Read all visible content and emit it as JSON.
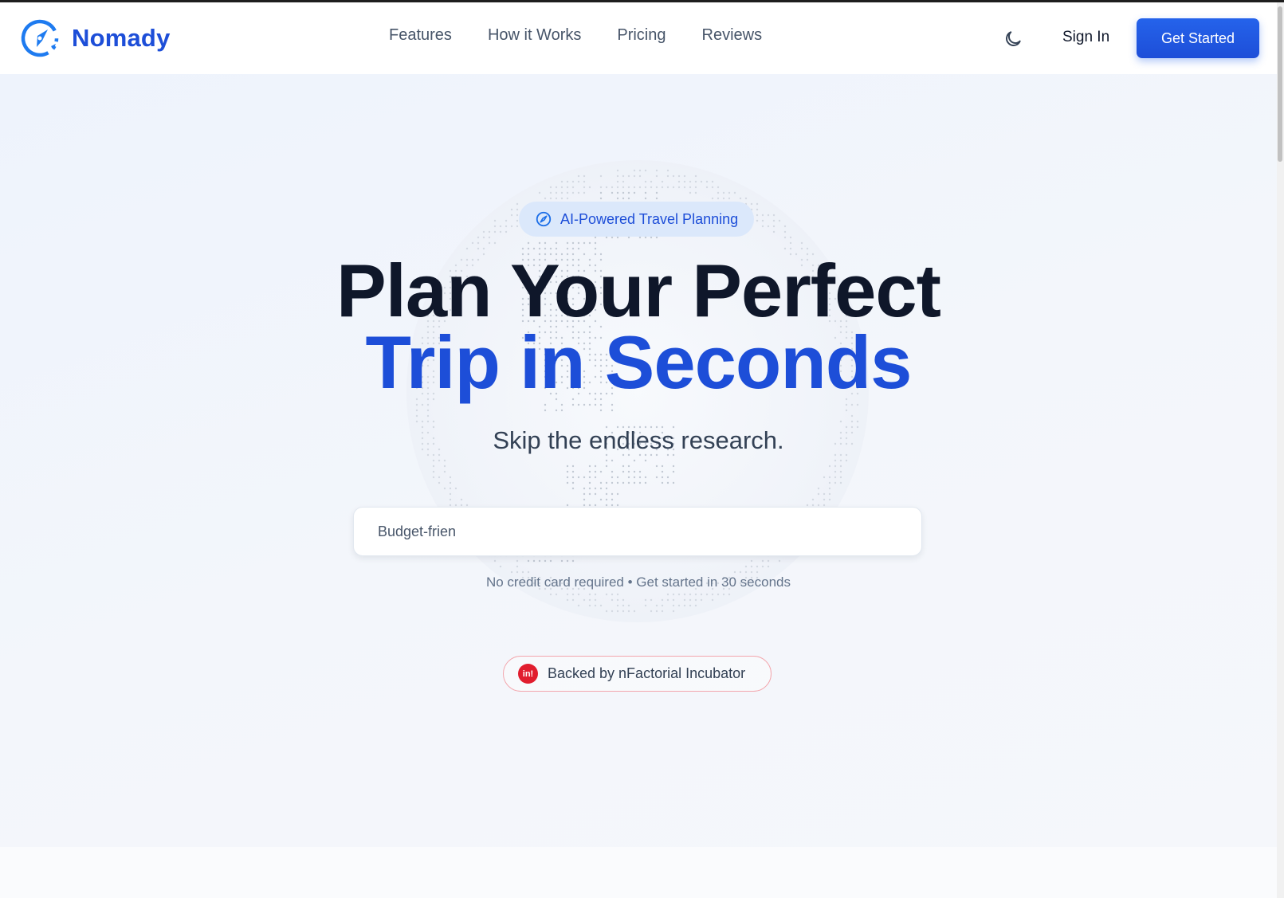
{
  "header": {
    "brand_name": "Nomady",
    "nav": [
      "Features",
      "How it Works",
      "Pricing",
      "Reviews"
    ],
    "theme_toggle_icon": "moon-icon",
    "sign_in_label": "Sign In",
    "get_started_label": "Get Started"
  },
  "hero": {
    "badge_label": "AI-Powered Travel Planning",
    "badge_icon": "compass-icon",
    "headline_line1": "Plan Your Perfect",
    "headline_line2": "Trip in Seconds",
    "subheadline": "Skip the endless research.",
    "search_value": "Budget-frien",
    "fineprint": "No credit card required • Get started in 30 seconds",
    "backed_logo_text": "in!",
    "backed_label": "Backed by nFactorial Incubator"
  },
  "colors": {
    "brand": "#1d4ed8",
    "accent_button": "#2563eb",
    "badge_bg": "#dbe8fb",
    "backed_border": "#f3a6ad",
    "backed_logo": "#e11d2e"
  }
}
